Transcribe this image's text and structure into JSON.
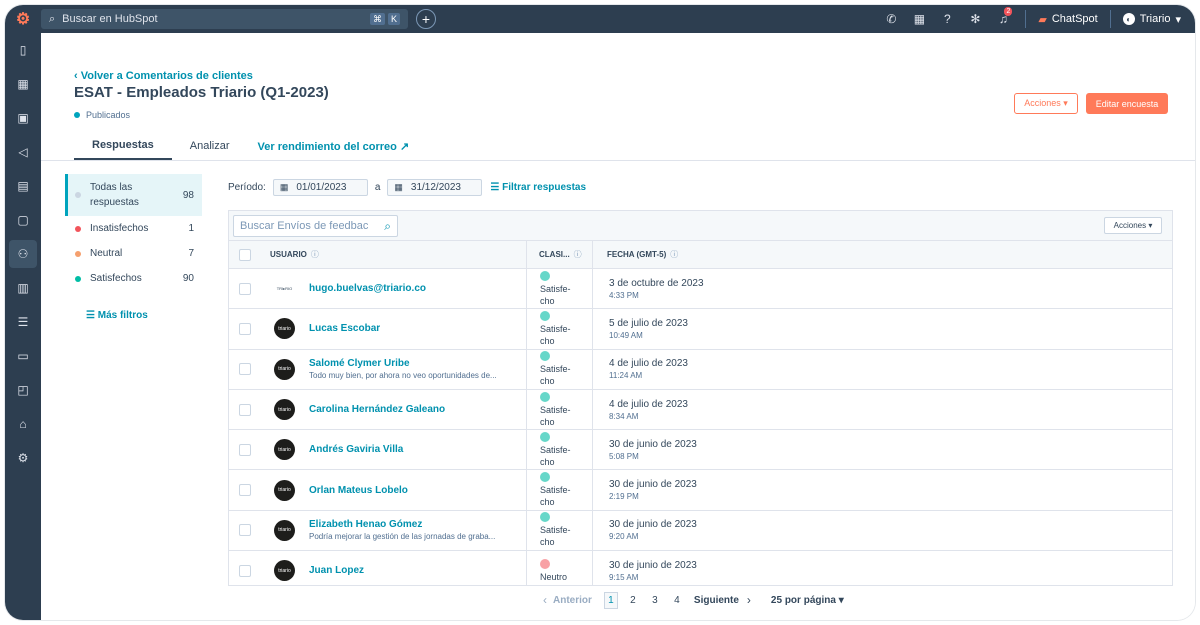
{
  "topnav": {
    "search_placeholder": "Buscar en HubSpot",
    "kbd": [
      "⌘",
      "K"
    ],
    "notif_count": "2",
    "chatspot": "ChatSpot",
    "account": "Triario"
  },
  "header": {
    "back_link": "‹ Volver a Comentarios de clientes",
    "title": "ESAT - Empleados Triario (Q1-2023)",
    "status": "Publicados",
    "actions_label": "Acciones ▾",
    "edit_label": "Editar encuesta"
  },
  "tabs": {
    "responses": "Respuestas",
    "analyze": "Analizar",
    "email_perf": "Ver rendimiento del correo ↗"
  },
  "filters": {
    "items": [
      {
        "label": "Todas las respuestas",
        "count": "98",
        "color": "#cbd6e2"
      },
      {
        "label": "Insatisfechos",
        "count": "1",
        "color": "#f2545b"
      },
      {
        "label": "Neutral",
        "count": "7",
        "color": "#f5a06e"
      },
      {
        "label": "Satisfechos",
        "count": "90",
        "color": "#00bda5"
      }
    ],
    "more": "☰ Más filtros"
  },
  "period": {
    "label": "Período:",
    "start": "01/01/2023",
    "to": "a",
    "end": "31/12/2023",
    "filter_link": "☰ Filtrar respuestas"
  },
  "table": {
    "search_placeholder": "Buscar Envíos de feedbac",
    "actions_label": "Acciones ▾",
    "headers": {
      "user": "USUARIO",
      "class": "CLASI...",
      "date": "FECHA (GMT-5)"
    },
    "rows": [
      {
        "avatar": "TRI▸RIO",
        "name": "hugo.buelvas@triario.co",
        "sub": "",
        "class": "Satisfe-\ncho",
        "date": "3 de octubre de 2023",
        "time": "4:33 PM",
        "neutral": false,
        "plain": true
      },
      {
        "avatar": "triario",
        "name": "Lucas Escobar",
        "sub": "",
        "class": "Satisfe-\ncho",
        "date": "5 de julio de 2023",
        "time": "10:49 AM",
        "neutral": false,
        "plain": false
      },
      {
        "avatar": "triario",
        "name": "Salomé Clymer Uribe",
        "sub": "Todo muy bien, por ahora no veo oportunidades de...",
        "class": "Satisfe-\ncho",
        "date": "4 de julio de 2023",
        "time": "11:24 AM",
        "neutral": false,
        "plain": false
      },
      {
        "avatar": "triario",
        "name": "Carolina Hernández Galeano",
        "sub": "",
        "class": "Satisfe-\ncho",
        "date": "4 de julio de 2023",
        "time": "8:34 AM",
        "neutral": false,
        "plain": false
      },
      {
        "avatar": "triario",
        "name": "Andrés Gaviria Villa",
        "sub": "",
        "class": "Satisfe-\ncho",
        "date": "30 de junio de 2023",
        "time": "5:08 PM",
        "neutral": false,
        "plain": false
      },
      {
        "avatar": "triario",
        "name": "Orlan Mateus Lobelo",
        "sub": "",
        "class": "Satisfe-\ncho",
        "date": "30 de junio de 2023",
        "time": "2:19 PM",
        "neutral": false,
        "plain": false
      },
      {
        "avatar": "triario",
        "name": "Elizabeth Henao Gómez",
        "sub": "Podría mejorar la gestión de las jornadas de graba...",
        "class": "Satisfe-\ncho",
        "date": "30 de junio de 2023",
        "time": "9:20 AM",
        "neutral": false,
        "plain": false
      },
      {
        "avatar": "triario",
        "name": "Juan Lopez",
        "sub": "",
        "class": "Neutro",
        "date": "30 de junio de 2023",
        "time": "9:15 AM",
        "neutral": true,
        "plain": false
      }
    ]
  },
  "pager": {
    "prev": "Anterior",
    "pages": [
      "1",
      "2",
      "3",
      "4"
    ],
    "next": "Siguiente",
    "per_page": "25 por página ▾"
  }
}
